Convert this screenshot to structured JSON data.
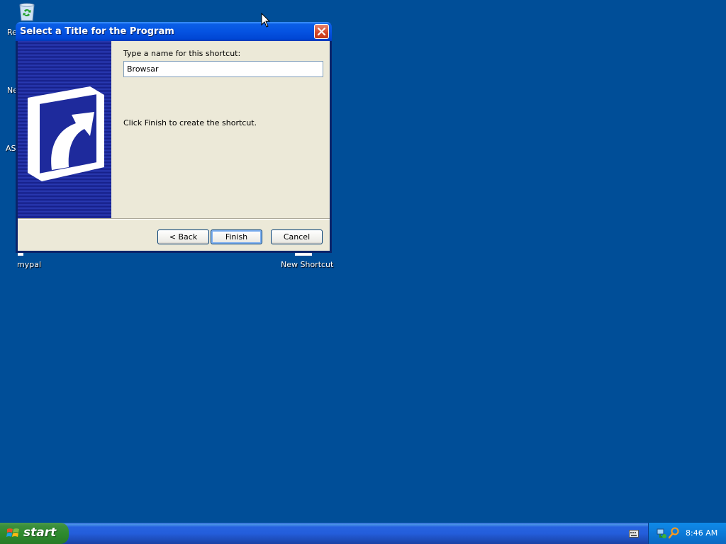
{
  "desktop": {
    "icons": [
      {
        "label": "Re"
      },
      {
        "label": "Ne"
      },
      {
        "label": "AS"
      },
      {
        "label": "mypal"
      },
      {
        "label": "New Shortcut"
      }
    ]
  },
  "dialog": {
    "title": "Select a Title for the Program",
    "name_label": "Type a name for this shortcut:",
    "name_value": "Browsar",
    "hint": "Click Finish to create the shortcut.",
    "buttons": {
      "back": "< Back",
      "finish": "Finish",
      "cancel": "Cancel"
    }
  },
  "taskbar": {
    "start_label": "start",
    "clock": "8:46 AM"
  },
  "colors": {
    "desktop": "#004e98",
    "titlebar": "#0553e2",
    "dialog_body": "#ece9d8",
    "start_button": "#2e8b2e"
  }
}
